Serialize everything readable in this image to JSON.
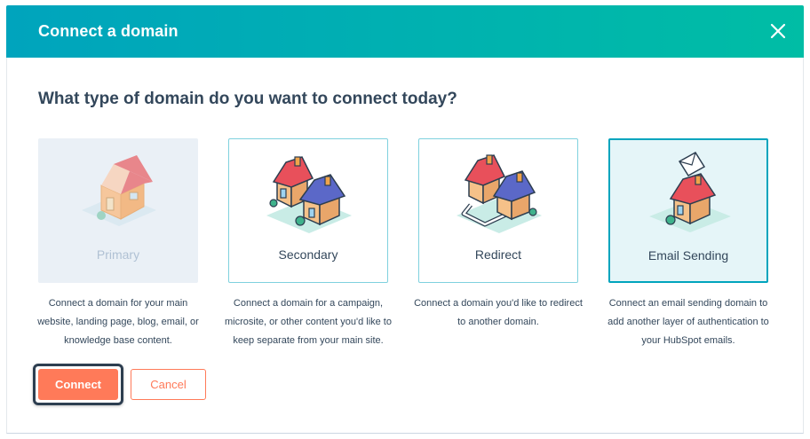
{
  "modal": {
    "title": "Connect a domain",
    "close_icon": "close-icon"
  },
  "question": "What type of domain do you want to connect today?",
  "options": [
    {
      "label": "Primary",
      "state": "disabled",
      "icon": "single-house-icon",
      "description": "Connect a domain for your main website, landing page, blog, email, or knowledge base content."
    },
    {
      "label": "Secondary",
      "state": "enabled",
      "icon": "two-houses-icon",
      "description": "Connect a domain for a campaign, microsite, or other content you'd like to keep separate from your main site."
    },
    {
      "label": "Redirect",
      "state": "enabled",
      "icon": "redirect-houses-icon",
      "description": "Connect a domain you'd like to redirect to another domain."
    },
    {
      "label": "Email Sending",
      "state": "selected",
      "icon": "email-house-icon",
      "description": "Connect an email sending domain to add another layer of authentication to your HubSpot emails."
    }
  ],
  "actions": {
    "connect_label": "Connect",
    "cancel_label": "Cancel"
  },
  "colors": {
    "header_start": "#00a4bd",
    "header_end": "#00bda5",
    "accent": "#ff7a59",
    "selected_border": "#00a4bd",
    "text": "#33475b"
  }
}
